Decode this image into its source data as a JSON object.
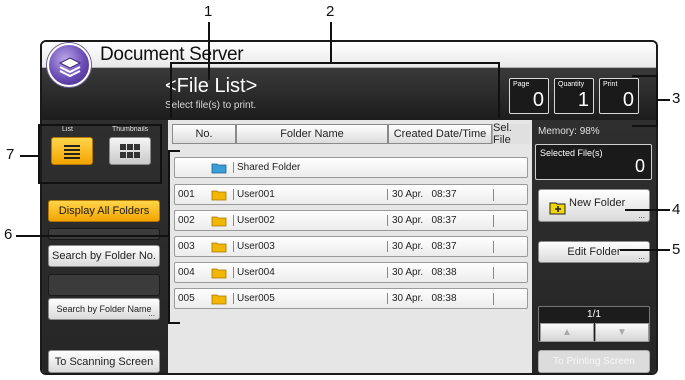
{
  "app": {
    "title": "Document Server"
  },
  "header": {
    "title": "<File List>",
    "subtitle": "Select file(s) to print.",
    "counters": [
      {
        "label": "Page",
        "value": "0"
      },
      {
        "label": "Quantity",
        "value": "1"
      },
      {
        "label": "Print",
        "value": "0"
      }
    ]
  },
  "left_panel": {
    "view_labels": {
      "list": "List",
      "thumbnails": "Thumbnails"
    },
    "icons": {
      "list": "list-view-icon",
      "thumbnails": "thumbnail-view-icon"
    },
    "display_all_folders": "Display All Folders",
    "search_by_folder_no": "Search by Folder No.",
    "search_by_folder_name": "Search by Folder Name",
    "to_scanning_screen": "To Scanning Screen"
  },
  "table": {
    "headers": {
      "no": "No.",
      "folder_name": "Folder Name",
      "created": "Created Date/Time",
      "sel_file": "Sel. File"
    },
    "shared_folder": {
      "name": "Shared Folder",
      "icon": "shared-folder-icon",
      "color": "#3a9fd9"
    },
    "rows": [
      {
        "no": "001",
        "name": "User001",
        "date": "30 Apr.",
        "time": "08:37"
      },
      {
        "no": "002",
        "name": "User002",
        "date": "30 Apr.",
        "time": "08:37"
      },
      {
        "no": "003",
        "name": "User003",
        "date": "30 Apr.",
        "time": "08:37"
      },
      {
        "no": "004",
        "name": "User004",
        "date": "30 Apr.",
        "time": "08:38"
      },
      {
        "no": "005",
        "name": "User005",
        "date": "30 Apr.",
        "time": "08:38"
      }
    ],
    "folder_color": "#f2b705"
  },
  "right_panel": {
    "memory_label": "Memory:",
    "memory_value": "98%",
    "selected_files_label": "Selected File(s)",
    "selected_files_value": "0",
    "new_folder": "New Folder",
    "edit_folder": "Edit Folder",
    "page_indicator": "1/1",
    "up_icon": "triangle-up-icon",
    "down_icon": "triangle-down-icon",
    "to_printing_screen": "To Printing Screen"
  },
  "callouts": [
    "1",
    "2",
    "3",
    "4",
    "5",
    "6",
    "7"
  ],
  "colors": {
    "accent_orange": "#f3a400",
    "panel_dark": "#2a2a2a",
    "logo_purple": "#6a4cb6"
  }
}
